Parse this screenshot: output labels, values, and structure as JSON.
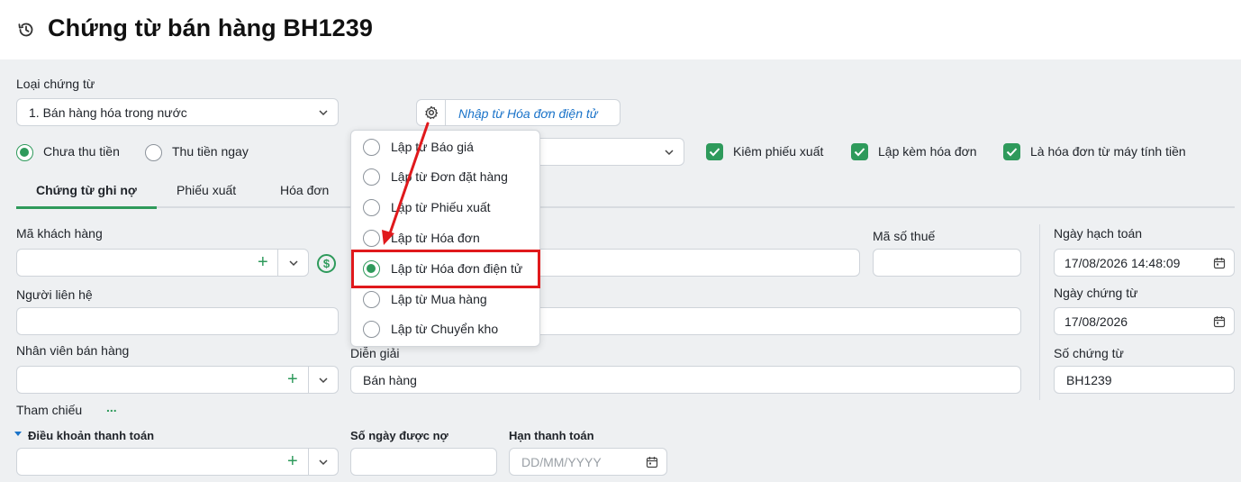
{
  "header": {
    "title": "Chứng từ bán hàng BH1239",
    "icon": "history-icon"
  },
  "voucher_type": {
    "label": "Loại chứng từ",
    "value": "1. Bán hàng hóa trong nước"
  },
  "import_button": {
    "label": "Nhập từ Hóa đơn điện tử",
    "icon": "gear-icon"
  },
  "payment_options": [
    {
      "label": "Chưa thu tiền",
      "selected": true
    },
    {
      "label": "Thu tiền ngay",
      "selected": false
    }
  ],
  "checkboxes": [
    {
      "label": "Kiêm phiếu xuất",
      "checked": true
    },
    {
      "label": "Lập kèm hóa đơn",
      "checked": true
    },
    {
      "label": "Là hóa đơn từ máy tính tiền",
      "checked": true
    }
  ],
  "tabs": [
    {
      "label": "Chứng từ ghi nợ",
      "active": true
    },
    {
      "label": "Phiếu xuất",
      "active": false
    },
    {
      "label": "Hóa đơn",
      "active": false
    }
  ],
  "dropdown": {
    "items": [
      {
        "label": "Lập từ Báo giá",
        "selected": false
      },
      {
        "label": "Lập từ Đơn đặt hàng",
        "selected": false
      },
      {
        "label": "Lập từ Phiếu xuất",
        "selected": false
      },
      {
        "label": "Lập từ Hóa đơn",
        "selected": false
      },
      {
        "label": "Lập từ Hóa đơn điện tử",
        "selected": true
      },
      {
        "label": "Lập từ Mua hàng",
        "selected": false
      },
      {
        "label": "Lập từ Chuyển kho",
        "selected": false
      }
    ]
  },
  "form": {
    "customer_code_label": "Mã khách hàng",
    "tax_code_label": "Mã số thuế",
    "contact_label": "Người liên hệ",
    "sales_staff_label": "Nhân viên bán hàng",
    "description_label": "Diễn giải",
    "description_value": "Bán hàng",
    "reference_label": "Tham chiếu",
    "reference_more": "...",
    "payment_terms_label": "Điều khoản thanh toán",
    "credit_days_label": "Số ngày được nợ",
    "due_date_label": "Hạn thanh toán",
    "due_date_placeholder": "DD/MM/YYYY",
    "currency_symbol": "$"
  },
  "right_panel": {
    "posting_date_label": "Ngày hạch toán",
    "posting_date_value": "17/08/2026 14:48:09",
    "voucher_date_label": "Ngày chứng từ",
    "voucher_date_value": "17/08/2026",
    "voucher_no_label": "Số chứng từ",
    "voucher_no_value": "BH1239"
  },
  "colors": {
    "accent": "#2e9a5b",
    "link": "#1a73c9",
    "highlight": "#e0191c",
    "arrow": "#e0191c"
  }
}
